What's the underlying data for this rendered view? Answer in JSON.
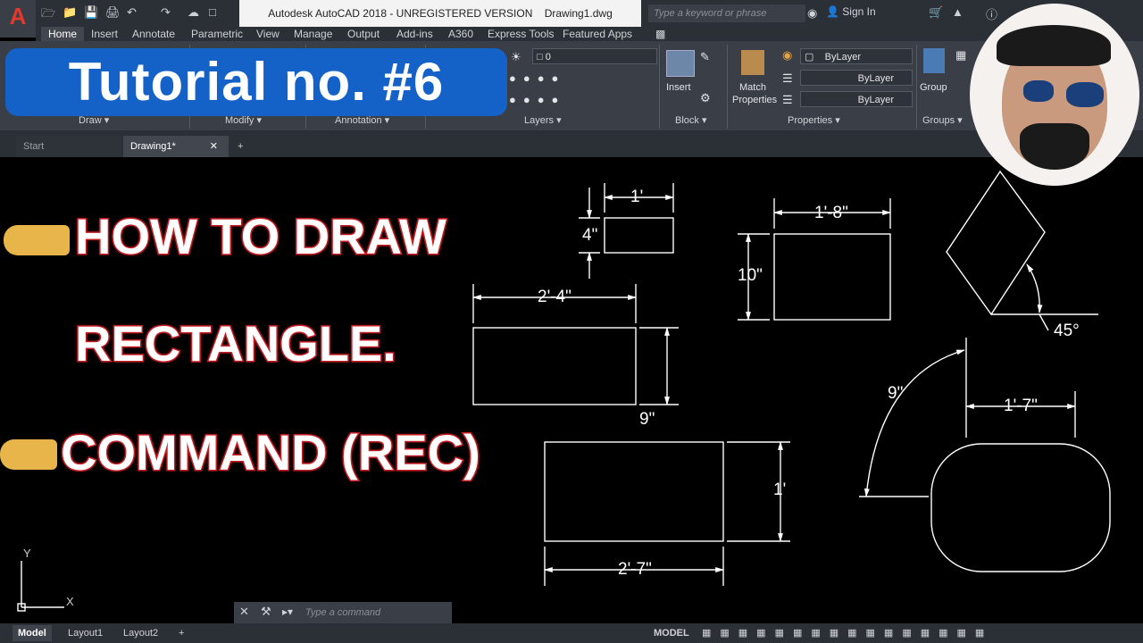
{
  "app": {
    "title": "Autodesk AutoCAD 2018 - UNREGISTERED VERSION",
    "filename": "Drawing1.dwg",
    "search_placeholder": "Type a keyword or phrase",
    "signin": "Sign In",
    "logo_letter": "A"
  },
  "menu_tabs": [
    "Home",
    "Insert",
    "Annotate",
    "Parametric",
    "View",
    "Manage",
    "Output",
    "Add-ins",
    "A360",
    "Express Tools",
    "Featured Apps"
  ],
  "ribbon": {
    "panels": [
      "Draw",
      "Modify",
      "Annotation",
      "Layers",
      "Block",
      "Properties",
      "Groups"
    ],
    "layer_value": "0",
    "insert_label": "Insert",
    "match_properties_line1": "Match",
    "match_properties_line2": "Properties",
    "bylayer_color": "ByLayer",
    "bylayer_linetype": "ByLayer",
    "bylayer_lineweight": "ByLayer",
    "group_label": "Group"
  },
  "file_tabs": [
    "Start",
    "Drawing1*"
  ],
  "overlay": {
    "banner": "Tutorial no. #6",
    "line1": "HOW TO DRAW",
    "line2": "RECTANGLE.",
    "line3": "COMMAND (REC)"
  },
  "dimensions": {
    "d1": "1'",
    "d2": "4\"",
    "d3": "1'-8\"",
    "d4": "10\"",
    "d5": "2'-4\"",
    "d6": "9\"",
    "d7": "45°",
    "d8": "9\"",
    "d9": "1'-7\"",
    "d10": "1'",
    "d11": "2'-7\""
  },
  "ucs": {
    "x": "X",
    "y": "Y"
  },
  "command": {
    "placeholder": "Type a command"
  },
  "status_tabs": [
    "Model",
    "Layout1",
    "Layout2"
  ],
  "status_model": "MODEL",
  "colors": {
    "ribbon": "#3a3f47",
    "banner": "#1461c7",
    "stroke_red": "#c41e24",
    "logo_red": "#e23a2e"
  }
}
